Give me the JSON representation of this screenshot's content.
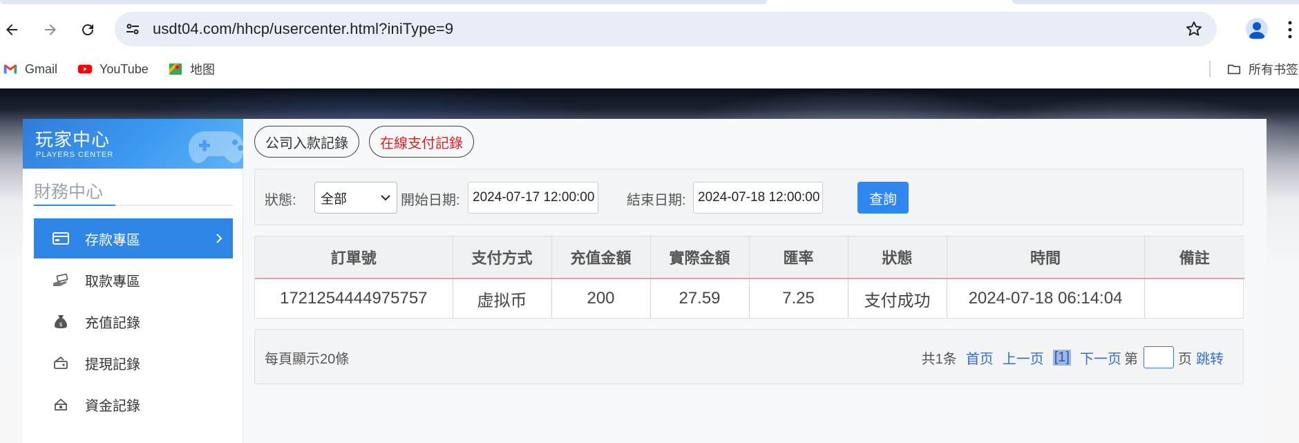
{
  "browser": {
    "url": "usdt04.com/hhcp/usercenter.html?iniType=9",
    "bookmarks": [
      {
        "label": "Gmail",
        "icon": "gmail-icon"
      },
      {
        "label": "YouTube",
        "icon": "youtube-icon"
      },
      {
        "label": "地图",
        "icon": "maps-icon"
      }
    ],
    "all_bookmarks": "所有书签"
  },
  "sidebar": {
    "brand_title": "玩家中心",
    "brand_subtitle": "PLAYERS CENTER",
    "section_title": "財務中心",
    "items": [
      {
        "label": "存款專區",
        "icon": "card-icon",
        "active": true
      },
      {
        "label": "取款專區",
        "icon": "cash-hand-icon",
        "active": false
      },
      {
        "label": "充值記錄",
        "icon": "money-bag-icon",
        "active": false
      },
      {
        "label": "提現記錄",
        "icon": "wallet-icon",
        "active": false
      },
      {
        "label": "資金記錄",
        "icon": "coins-icon",
        "active": false
      }
    ]
  },
  "tabs": [
    {
      "label": "公司入款記錄",
      "active": false
    },
    {
      "label": "在線支付記錄",
      "active": true
    }
  ],
  "filter": {
    "status_label": "狀態:",
    "status_value": "全部",
    "start_label": "開始日期:",
    "start_value": "2024-07-17 12:00:00",
    "end_label": "結束日期:",
    "end_value": "2024-07-18 12:00:00",
    "query_label": "查詢"
  },
  "table": {
    "columns": [
      "訂單號",
      "支付方式",
      "充值金額",
      "實際金額",
      "匯率",
      "狀態",
      "時間",
      "備註"
    ],
    "rows": [
      [
        "1721254444975757",
        "虚拟币",
        "200",
        "27.59",
        "7.25",
        "支付成功",
        "2024-07-18 06:14:04",
        ""
      ]
    ]
  },
  "pagination": {
    "per_page": "每頁顯示20條",
    "total": "共1条",
    "first": "首页",
    "prev": "上一页",
    "current": "[1]",
    "next": "下一页",
    "page_prefix": "第",
    "page_suffix": "页",
    "jump": "跳转"
  },
  "colors": {
    "accent": "#2f86e6",
    "active_tab_text": "#e02020",
    "link": "#2f6fd0"
  }
}
